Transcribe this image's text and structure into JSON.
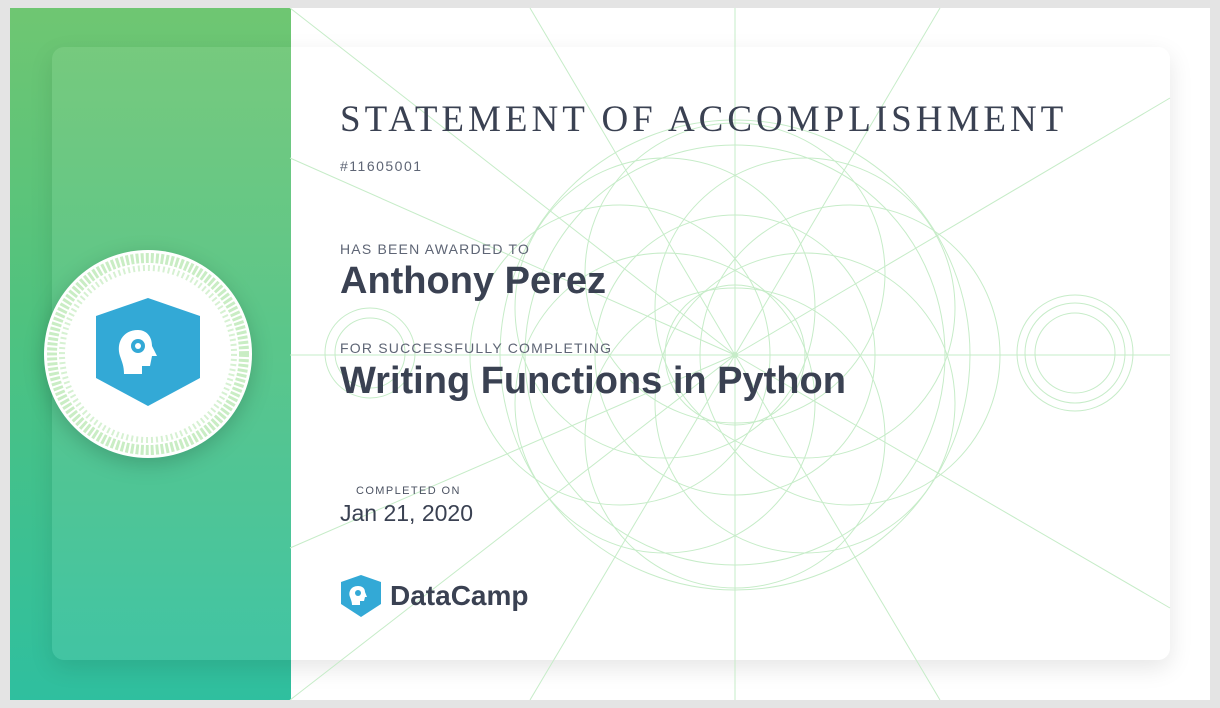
{
  "certificate": {
    "title": "STATEMENT OF ACCOMPLISHMENT",
    "id": "#11605001",
    "awarded_label": "HAS BEEN AWARDED TO",
    "recipient": "Anthony Perez",
    "for_label": "FOR SUCCESSFULLY COMPLETING",
    "course": "Writing Functions in Python",
    "completed_label": "COMPLETED ON",
    "completed_date": "Jan 21, 2020"
  },
  "brand": {
    "name": "DataCamp",
    "logo_icon": "datacamp-brain-gear-icon"
  },
  "colors": {
    "panel_top": "#6fc672",
    "panel_bottom": "#2fbf9f",
    "logo_blue": "#33a9d6",
    "text": "#3a4152",
    "guilloche": "#bfe8c1"
  }
}
